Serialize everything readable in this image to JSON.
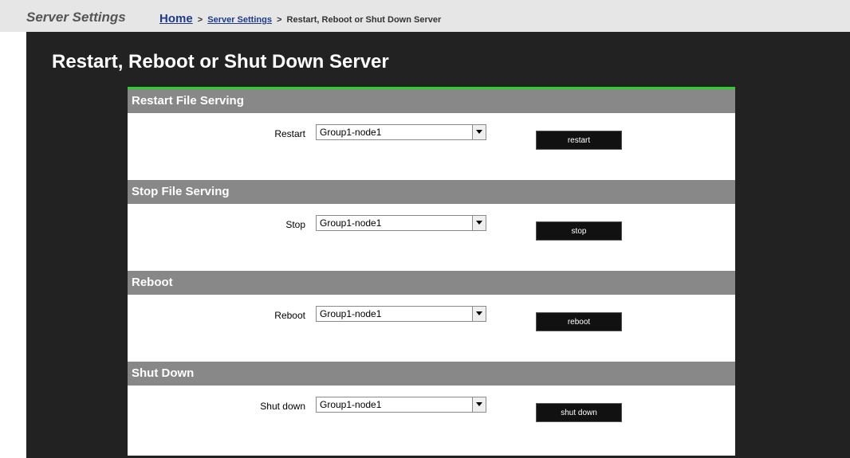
{
  "header": {
    "app_title": "Server Settings",
    "breadcrumb": {
      "home": "Home",
      "sep1": ">",
      "server_settings": "Server Settings",
      "sep2": ">",
      "current": "Restart, Reboot or Shut Down Server"
    }
  },
  "main": {
    "title": "Restart, Reboot or Shut Down Server",
    "accent_color": "#2fcc2f",
    "sections": [
      {
        "header": "Restart File Serving",
        "label": "Restart",
        "selected": "Group1-node1",
        "button": "restart"
      },
      {
        "header": "Stop File Serving",
        "label": "Stop",
        "selected": "Group1-node1",
        "button": "stop"
      },
      {
        "header": "Reboot",
        "label": "Reboot",
        "selected": "Group1-node1",
        "button": "reboot"
      },
      {
        "header": "Shut Down",
        "label": "Shut down",
        "selected": "Group1-node1",
        "button": "shut down"
      }
    ]
  }
}
